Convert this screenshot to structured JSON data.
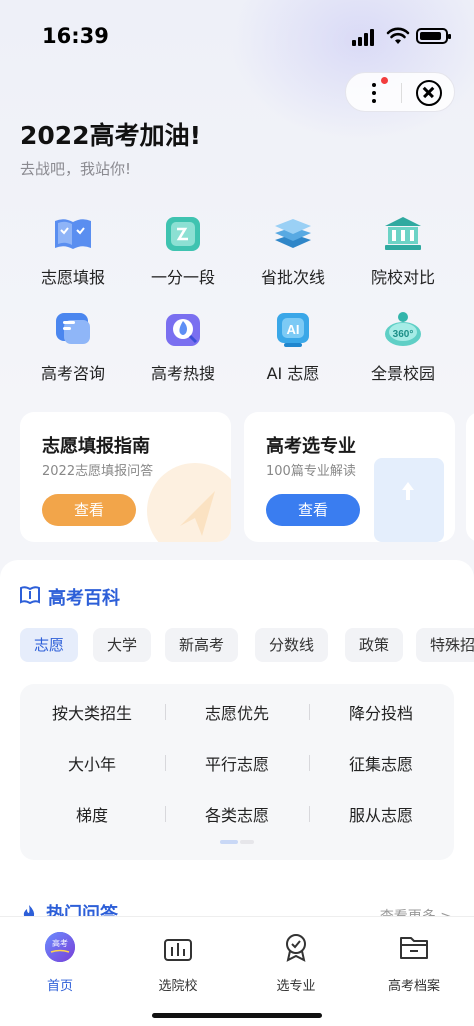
{
  "status_bar": {
    "time": "16:39"
  },
  "header": {
    "title": "2022高考加油!",
    "subtitle": "去战吧，我站你!"
  },
  "capsule": {
    "more_icon": "more-icon",
    "close_icon": "close-icon",
    "badge_color": "#f23d3d"
  },
  "grid": [
    {
      "label": "志愿填报",
      "icon": "form-book-icon"
    },
    {
      "label": "一分一段",
      "icon": "score-segment-icon"
    },
    {
      "label": "省批次线",
      "icon": "layers-icon"
    },
    {
      "label": "院校对比",
      "icon": "school-building-icon"
    },
    {
      "label": "高考咨询",
      "icon": "chat-bubble-icon"
    },
    {
      "label": "高考热搜",
      "icon": "hot-search-icon"
    },
    {
      "label": "AI 志愿",
      "icon": "ai-badge-icon",
      "badge": "AI"
    },
    {
      "label": "全景校园",
      "icon": "panorama-360-icon",
      "badge": "360°"
    }
  ],
  "cards": [
    {
      "title": "志愿填报指南",
      "subtitle": "2022志愿填报问答",
      "button": "查看",
      "button_color": "#f2a54a"
    },
    {
      "title": "高考选专业",
      "subtitle": "100篇专业解读",
      "button": "查看",
      "button_color": "#3a7df0"
    }
  ],
  "encyclopedia": {
    "title": "高考百科",
    "tabs": [
      "志愿",
      "大学",
      "新高考",
      "分数线",
      "政策",
      "特殊招"
    ],
    "active_tab": "志愿",
    "tags": [
      "按大类招生",
      "志愿优先",
      "降分投档",
      "大小年",
      "平行志愿",
      "征集志愿",
      "梯度",
      "各类志愿",
      "服从志愿"
    ]
  },
  "hot_qa": {
    "title": "热门问答",
    "more": "查看更多 >"
  },
  "tabbar": [
    {
      "label": "首页",
      "icon": "home-logo-icon",
      "active": true,
      "logo_text": "高考"
    },
    {
      "label": "选院校",
      "icon": "building-chart-icon"
    },
    {
      "label": "选专业",
      "icon": "medal-icon"
    },
    {
      "label": "高考档案",
      "icon": "folder-icon"
    }
  ],
  "colors": {
    "accent": "#2d5fd8",
    "orange": "#f2a54a",
    "blue_button": "#3a7df0"
  }
}
